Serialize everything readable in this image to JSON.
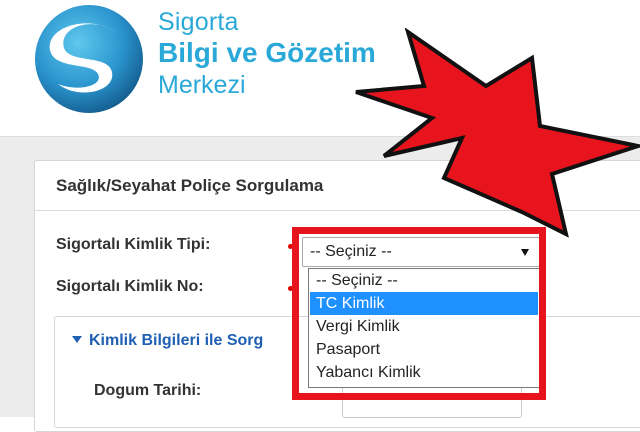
{
  "brand": {
    "line1": "Sigorta",
    "line2": "Bilgi ve Gözetim",
    "line3": "Merkezi",
    "logo": "sbm-s-swoosh-logo",
    "colors": {
      "primary": "#2aa9d8",
      "dark": "#1b6fa3"
    }
  },
  "panel": {
    "title": "Sağlık/Seyahat Poliçe Sorgulama"
  },
  "form": {
    "kimlik_tipi_label": "Sigortalı Kimlik Tipi:",
    "kimlik_no_label": "Sigortalı Kimlik No:",
    "select_value": "-- Seçiniz --",
    "options": [
      {
        "label": "-- Seçiniz --",
        "selected": false
      },
      {
        "label": "TC Kimlik",
        "selected": true
      },
      {
        "label": "Vergi Kimlik",
        "selected": false
      },
      {
        "label": "Pasaport",
        "selected": false
      },
      {
        "label": "Yabancı Kimlik",
        "selected": false
      }
    ]
  },
  "section": {
    "title": "Kimlik Bilgileri ile Sorg",
    "dogum_label": "Dogum Tarihi:"
  },
  "annotation": {
    "color": "#e8141d",
    "icon": "red-arrow-icon",
    "frame": "red-highlight-box"
  },
  "colors": {
    "selected_option": "#1e90ff",
    "link": "#1f5fb4",
    "required": "#e00000"
  }
}
